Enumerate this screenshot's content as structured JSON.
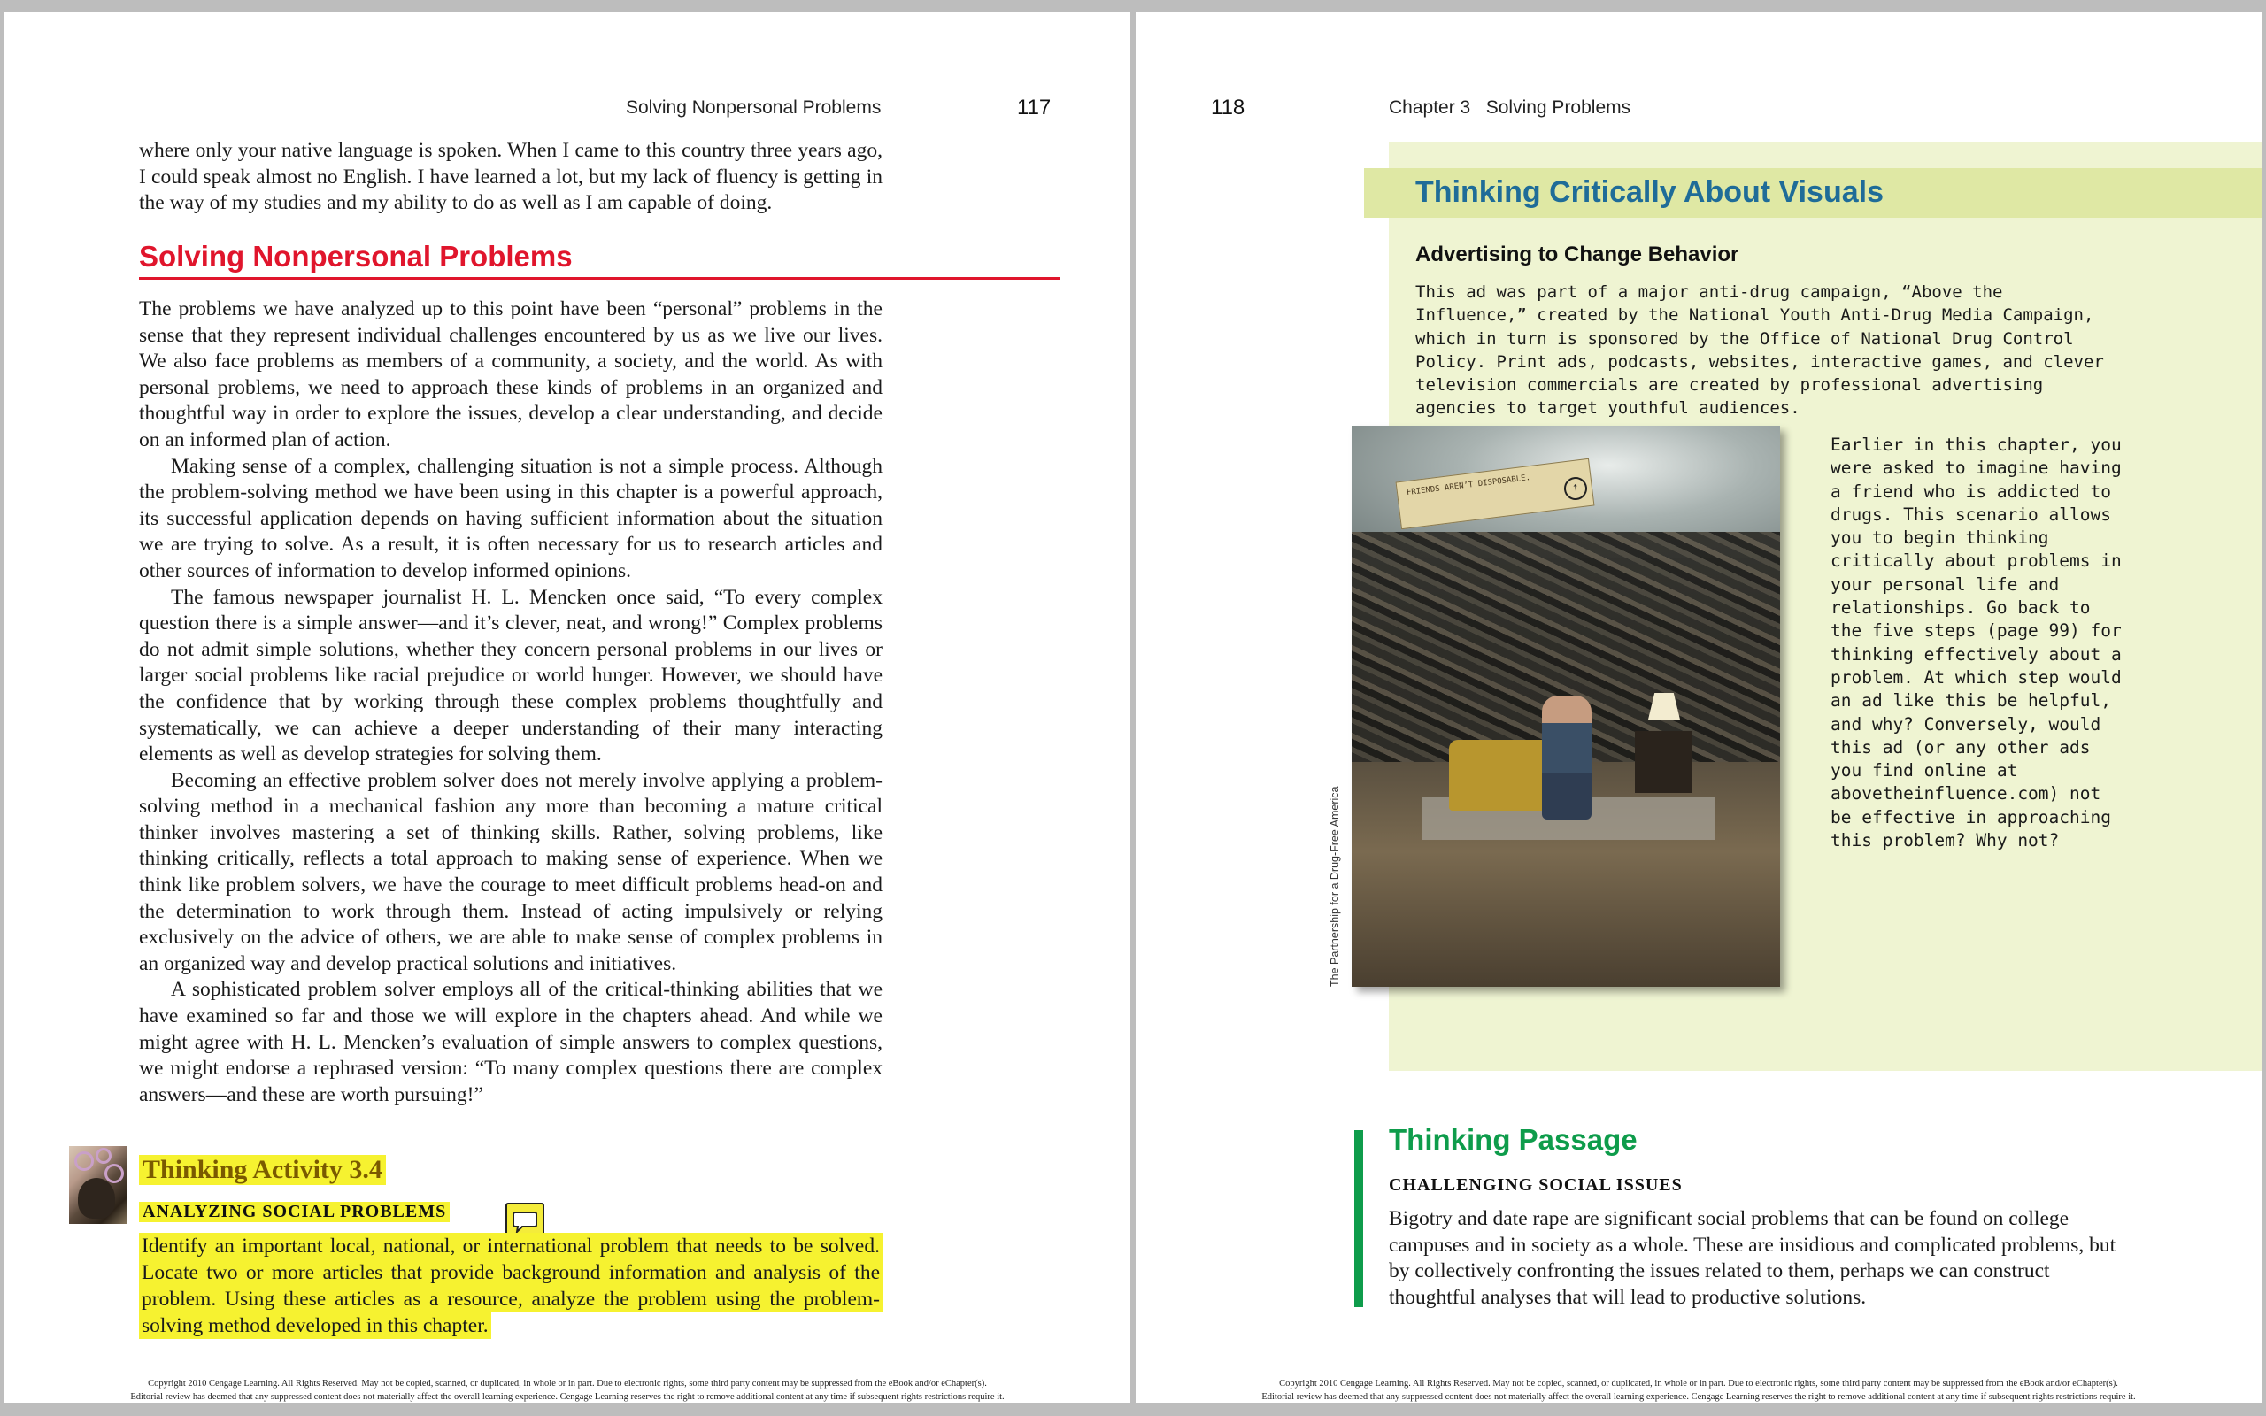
{
  "left_page": {
    "running_head": "Solving Nonpersonal Problems",
    "page_number": "117",
    "intro_paragraph": "where only your native language is spoken. When I came to this country three years ago, I could speak almost no English. I have learned a lot, but my lack of fluency is getting in the way of my studies and my ability to do as well as I am capable of doing.",
    "section_heading": "Solving Nonpersonal Problems",
    "paragraphs": [
      "The problems we have analyzed up to this point have been “personal” problems in the sense that they represent individual challenges encountered by us as we live our lives. We also face problems as members of a community, a society, and the world. As with personal problems, we need to approach these kinds of problems in an organized and thoughtful way in order to explore the issues, develop a clear understanding, and decide on an informed plan of action.",
      "Making sense of a complex, challenging situation is not a simple process. Although the problem-solving method we have been using in this chapter is a powerful approach, its successful application depends on having sufficient information about the situation we are trying to solve. As a result, it is often necessary for us to research articles and other sources of information to develop informed opinions.",
      "The famous newspaper journalist H. L. Mencken once said, “To every complex question there is a simple answer—and it’s clever, neat, and wrong!” Complex problems do not admit simple solutions, whether they concern personal problems in our lives or larger social problems like racial prejudice or world hunger. However, we should have the confidence that by working through these complex problems thoughtfully and systematically, we can achieve a deeper understanding of their many interacting elements as well as develop strategies for solving them.",
      "Becoming an effective problem solver does not merely involve applying a problem-solving method in a mechanical fashion any more than becoming a mature critical thinker involves mastering a set of thinking skills. Rather, solving problems, like thinking critically, reflects a total approach to making sense of experience. When we think like problem solvers, we have the courage to meet difficult problems head-on and the determination to work through them. Instead of acting impulsively or relying exclusively on the advice of others, we are able to make sense of complex problems in an organized way and develop practical solutions and initiatives.",
      "A sophisticated problem solver employs all of the critical-thinking abilities that we have examined so far and those we will explore in the chapters ahead. And while we might agree with H. L. Mencken’s evaluation of simple answers to complex questions, we might endorse a rephrased version: “To many complex questions there are complex answers—and these are worth pursuing!”"
    ],
    "activity": {
      "title": "Thinking Activity 3.4",
      "subtitle": "ANALYZING SOCIAL PROBLEMS",
      "body": "Identify an important local, national, or international problem that needs to be solved. Locate two or more articles that provide background information and analysis of the problem. Using these articles as a resource, analyze the problem using the problem-solving method developed in this chapter."
    },
    "copyright_line1": "Copyright 2010 Cengage Learning. All Rights Reserved. May not be copied, scanned, or duplicated, in whole or in part. Due to electronic rights, some third party content may be suppressed from the eBook and/or eChapter(s).",
    "copyright_line2": "Editorial review has deemed that any suppressed content does not materially affect the overall learning experience. Cengage Learning reserves the right to remove additional content at any time if subsequent rights restrictions require it."
  },
  "right_page": {
    "page_number": "118",
    "running_head": "Chapter 3   Solving Problems",
    "visuals": {
      "title": "Thinking Critically About Visuals",
      "subtitle": "Advertising to Change Behavior",
      "intro": "This ad was part of a major anti-drug campaign, “Above the Influence,” created by the National Youth Anti-Drug Media Campaign, which in turn is sponsored by the Office of National Drug Control Policy. Print ads, podcasts, websites, interactive games, and clever television commercials are created by professional advertising agencies to target youthful audiences.",
      "photo_sign_text": "FRIENDS AREN’T DISPOSABLE.",
      "photo_credit": "The Partnership for a Drug-Free America",
      "question": "Earlier in this chapter, you were asked to imagine having a friend who is addicted to drugs. This scenario allows you to begin thinking critically about problems in your personal life and relationships. Go back to the five steps (page 99) for thinking effectively about a problem. At which step would an ad like this be helpful, and why? Conversely, would this ad (or any other ads you find online at abovetheinfluence.com) not be effective in approaching this problem? Why not?"
    },
    "passage": {
      "title": "Thinking Passage",
      "subtitle": "CHALLENGING SOCIAL ISSUES",
      "body": "Bigotry and date rape are significant social problems that can be found on college campuses and in society as a whole. These are insidious and complicated problems, but by collectively confronting the issues related to them, perhaps we can construct thoughtful analyses that will lead to productive solutions."
    },
    "copyright_line1": "Copyright 2010 Cengage Learning. All Rights Reserved. May not be copied, scanned, or duplicated, in whole or in part. Due to electronic rights, some third party content may be suppressed from the eBook and/or eChapter(s).",
    "copyright_line2": "Editorial review has deemed that any suppressed content does not materially affect the overall learning experience. Cengage Learning reserves the right to remove additional content at any time if subsequent rights restrictions require it."
  },
  "colors": {
    "section_heading": "#e0152c",
    "visuals_title": "#1f6c98",
    "visuals_background": "#eff4d2",
    "passage_accent": "#0e9c4b",
    "highlight": "#f6f230"
  },
  "icons": {
    "comment": "speech-bubble-icon",
    "activity_thumbnail": "thinking-activity-thumbnail"
  }
}
